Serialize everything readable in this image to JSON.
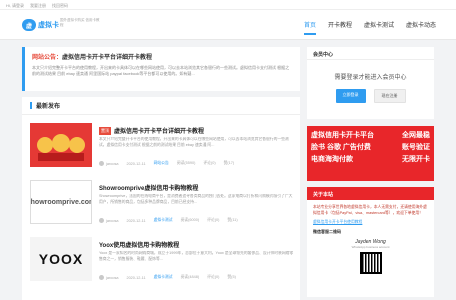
{
  "topbar": {
    "links": [
      "Hi, 请登录",
      "我要注册",
      "找回密码"
    ]
  },
  "header": {
    "logo_mark": "虚",
    "logo_text": "虚拟卡",
    "slogan": "国外虚拟卡购买 信用卡教程",
    "nav": [
      {
        "label": "首页",
        "active": true
      },
      {
        "label": "开卡教程",
        "active": false
      },
      {
        "label": "虚拟卡测试",
        "active": false
      },
      {
        "label": "虚拟卡动态",
        "active": false
      }
    ]
  },
  "notice": {
    "prefix": "网站公告：",
    "title": "虚拟信用卡开卡平台详细开卡教程",
    "body": "本文只介绍完整开卡平台的使用教程，开出来的卡具体可以在哪些网站使用，可以去本站浏览其它各银行的一些测试。虚拟信用卡支付测试 根据之前的测试结果 目前 ebay 速卖通 阿里国际站 paypal facebook等平台都可以使用的。如有疑..."
  },
  "latest": {
    "heading": "最新发布",
    "posts": [
      {
        "tag": "置顶",
        "title": "虚拟信用卡开卡平台详细开卡教程",
        "excerpt": "本文只介绍完整开卡平台的使用教程，开出来的卡具体可以在哪些网站使用，可以去本站浏览其它各银行的一些测试。虚拟信用卡支付测试 根据之前的测试结果 目前 ebay 速卖通 阿...",
        "thumb_text": "",
        "author": "jaroosa",
        "date": "2020-12-11",
        "category": "网站公告",
        "views": "阅读(5590)",
        "comments": "评论(0)",
        "likes": "赞(17)"
      },
      {
        "tag": "",
        "title": "Showroomprive虚拟信用卡购物教程",
        "excerpt": "Showroomprive，法国的在线电商平台，是消费者追寻各类商品的独门去处。这家电商以打折和闪购模式吸引了广大用户，所销售的商品，包括多种品牌商品，目前已经支持...",
        "thumb_text": "showroomprive.com",
        "author": "jaroosa",
        "date": "2020-12-11",
        "category": "虚拟卡测试",
        "views": "阅读(6000)",
        "comments": "评论(0)",
        "likes": "赞(11)"
      },
      {
        "tag": "",
        "title": "Yoox使用虚拟信用卡购物教程",
        "excerpt": "Yoox 是一家知名的时尚网购商城，成立于1999年，总部位于意大利。Yoox 是全球领先的奢侈品、设计师时装网络零售商之一，销售服装、鞋履、配饰等...",
        "thumb_text": "YOOX",
        "author": "jaroosa",
        "date": "2020-12-11",
        "category": "虚拟卡测试",
        "views": "阅读(4848)",
        "comments": "评论(0)",
        "likes": "赞(5)"
      }
    ]
  },
  "sidebar": {
    "member": {
      "heading": "会员中心",
      "message": "需要登录才能进入会员中心",
      "login_label": "立即登录",
      "register_label": "现在注册"
    },
    "ad": {
      "rows": [
        [
          "虚拟信用卡开卡平台",
          "全网最稳"
        ],
        [
          "脸书 谷歌 广告付费",
          "账号验证"
        ],
        [
          "电商海淘付款",
          "无限开卡"
        ]
      ]
    },
    "about": {
      "heading": "关于本站",
      "text": "本站专业分享世界各地虚拟信用卡，本人无需支付，还请使用海外虚拟信用卡（包括PayPal、visa、mastercard等），欢迎下单使用！",
      "link": "虚拟信用卡开卡平台使用教程",
      "wechat_label": "微信客服二维码",
      "signature": "Jayden Wong",
      "signature_sub": "WhatsApp business account"
    }
  },
  "colors": {
    "accent": "#2f9cf0",
    "ad_red": "#e8262a",
    "tag_red": "#e74c3c"
  }
}
